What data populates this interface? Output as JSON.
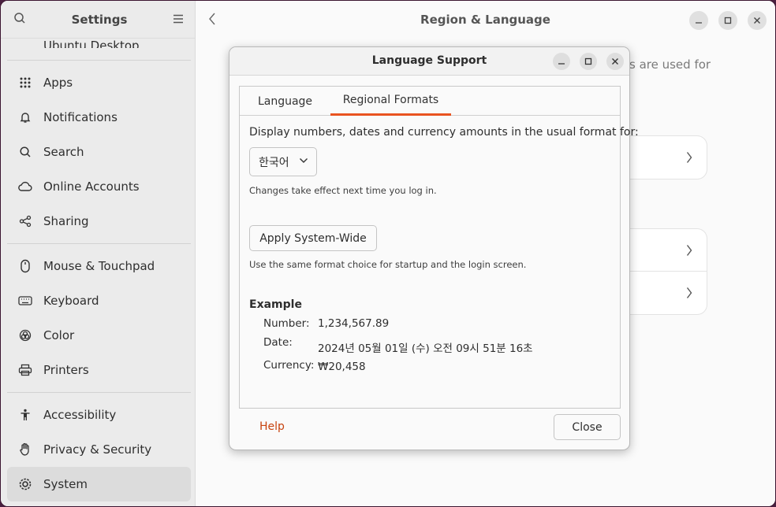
{
  "sidebar": {
    "title": "Settings",
    "partial_item": "Ubuntu Desktop",
    "groups": [
      [
        {
          "label": "Apps",
          "icon": "apps-grid-icon"
        },
        {
          "label": "Notifications",
          "icon": "bell-icon"
        },
        {
          "label": "Search",
          "icon": "search-icon"
        },
        {
          "label": "Online Accounts",
          "icon": "cloud-icon"
        },
        {
          "label": "Sharing",
          "icon": "share-icon"
        }
      ],
      [
        {
          "label": "Mouse & Touchpad",
          "icon": "mouse-icon"
        },
        {
          "label": "Keyboard",
          "icon": "keyboard-icon"
        },
        {
          "label": "Color",
          "icon": "color-icon"
        },
        {
          "label": "Printers",
          "icon": "printer-icon"
        }
      ],
      [
        {
          "label": "Accessibility",
          "icon": "accessibility-icon"
        },
        {
          "label": "Privacy & Security",
          "icon": "hand-icon"
        },
        {
          "label": "System",
          "icon": "gear-icon",
          "active": true
        }
      ]
    ]
  },
  "main": {
    "title": "Region & Language",
    "background_text": "s are used for"
  },
  "dialog": {
    "title": "Language Support",
    "tabs": [
      {
        "label": "Language",
        "active": false
      },
      {
        "label": "Regional Formats",
        "active": true
      }
    ],
    "prompt": "Display numbers, dates and currency amounts in the usual format for:",
    "selected_format": "한국어",
    "note1": "Changes take effect next time you log in.",
    "apply_button": "Apply System-Wide",
    "note2": "Use the same format choice for startup and the login screen.",
    "example": {
      "title": "Example",
      "number_label": "Number:",
      "number_value": "1,234,567.89",
      "date_label": "Date:",
      "date_value": "2024년 05월 01일 (수) 오전 09시 51분 16초",
      "currency_label": "Currency:",
      "currency_value": "₩20,458"
    },
    "help": "Help",
    "close": "Close"
  },
  "colors": {
    "accent": "#e95420",
    "link": "#c7430f"
  }
}
